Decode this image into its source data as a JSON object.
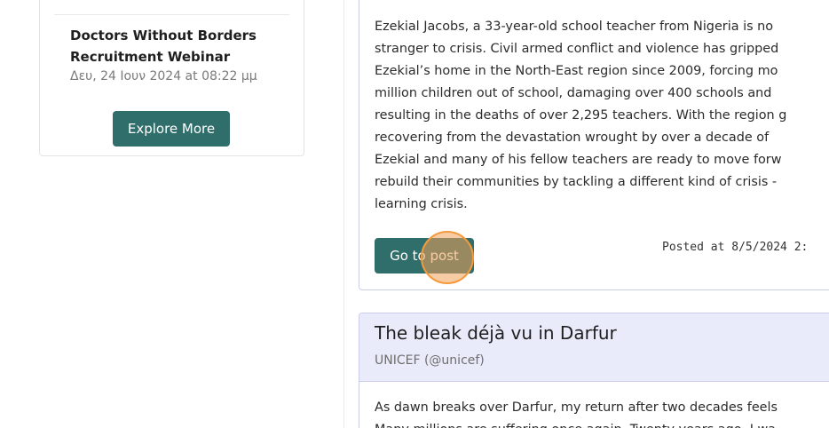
{
  "event": {
    "title": "Doctors Without Borders Recruitment Webinar",
    "date": "Δευ, 24 Ιουν 2024 at 08:22 μμ",
    "button_label": "Explore More"
  },
  "post1": {
    "body": "Ezekial Jacobs, a 33-year-old school teacher from Nigeria is no\nstranger to crisis. Civil armed conflict and violence has gripped\nEzekial’s home in the North-East region since 2009, forcing mo\nmillion children out of school, damaging over 400 schools and\nresulting in the deaths of over 2,295 teachers. With the region g\nrecovering from the devastation wrought by over a decade of\nEzekial and many of his fellow teachers are ready to move forw\nrebuild their communities by tackling a different kind of crisis -\nlearning crisis.",
    "button_label": "Go to post",
    "posted_at": "Posted at 8/5/2024 2:"
  },
  "post2": {
    "title": "The bleak déjà vu in Darfur",
    "author": "UNICEF (@unicef)",
    "body": "As dawn breaks over Darfur, my return after two decades feels\nMany millions are suffering once again. Twenty years ago, I wa"
  }
}
